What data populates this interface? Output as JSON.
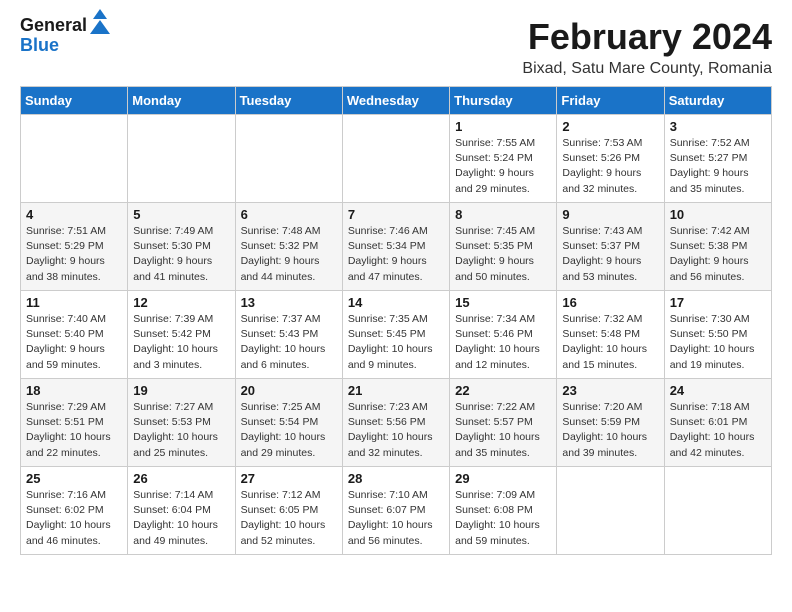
{
  "header": {
    "logo_line1": "General",
    "logo_line2": "Blue",
    "title": "February 2024",
    "subtitle": "Bixad, Satu Mare County, Romania"
  },
  "calendar": {
    "days_of_week": [
      "Sunday",
      "Monday",
      "Tuesday",
      "Wednesday",
      "Thursday",
      "Friday",
      "Saturday"
    ],
    "weeks": [
      [
        {
          "day": "",
          "info": ""
        },
        {
          "day": "",
          "info": ""
        },
        {
          "day": "",
          "info": ""
        },
        {
          "day": "",
          "info": ""
        },
        {
          "day": "1",
          "info": "Sunrise: 7:55 AM\nSunset: 5:24 PM\nDaylight: 9 hours\nand 29 minutes."
        },
        {
          "day": "2",
          "info": "Sunrise: 7:53 AM\nSunset: 5:26 PM\nDaylight: 9 hours\nand 32 minutes."
        },
        {
          "day": "3",
          "info": "Sunrise: 7:52 AM\nSunset: 5:27 PM\nDaylight: 9 hours\nand 35 minutes."
        }
      ],
      [
        {
          "day": "4",
          "info": "Sunrise: 7:51 AM\nSunset: 5:29 PM\nDaylight: 9 hours\nand 38 minutes."
        },
        {
          "day": "5",
          "info": "Sunrise: 7:49 AM\nSunset: 5:30 PM\nDaylight: 9 hours\nand 41 minutes."
        },
        {
          "day": "6",
          "info": "Sunrise: 7:48 AM\nSunset: 5:32 PM\nDaylight: 9 hours\nand 44 minutes."
        },
        {
          "day": "7",
          "info": "Sunrise: 7:46 AM\nSunset: 5:34 PM\nDaylight: 9 hours\nand 47 minutes."
        },
        {
          "day": "8",
          "info": "Sunrise: 7:45 AM\nSunset: 5:35 PM\nDaylight: 9 hours\nand 50 minutes."
        },
        {
          "day": "9",
          "info": "Sunrise: 7:43 AM\nSunset: 5:37 PM\nDaylight: 9 hours\nand 53 minutes."
        },
        {
          "day": "10",
          "info": "Sunrise: 7:42 AM\nSunset: 5:38 PM\nDaylight: 9 hours\nand 56 minutes."
        }
      ],
      [
        {
          "day": "11",
          "info": "Sunrise: 7:40 AM\nSunset: 5:40 PM\nDaylight: 9 hours\nand 59 minutes."
        },
        {
          "day": "12",
          "info": "Sunrise: 7:39 AM\nSunset: 5:42 PM\nDaylight: 10 hours\nand 3 minutes."
        },
        {
          "day": "13",
          "info": "Sunrise: 7:37 AM\nSunset: 5:43 PM\nDaylight: 10 hours\nand 6 minutes."
        },
        {
          "day": "14",
          "info": "Sunrise: 7:35 AM\nSunset: 5:45 PM\nDaylight: 10 hours\nand 9 minutes."
        },
        {
          "day": "15",
          "info": "Sunrise: 7:34 AM\nSunset: 5:46 PM\nDaylight: 10 hours\nand 12 minutes."
        },
        {
          "day": "16",
          "info": "Sunrise: 7:32 AM\nSunset: 5:48 PM\nDaylight: 10 hours\nand 15 minutes."
        },
        {
          "day": "17",
          "info": "Sunrise: 7:30 AM\nSunset: 5:50 PM\nDaylight: 10 hours\nand 19 minutes."
        }
      ],
      [
        {
          "day": "18",
          "info": "Sunrise: 7:29 AM\nSunset: 5:51 PM\nDaylight: 10 hours\nand 22 minutes."
        },
        {
          "day": "19",
          "info": "Sunrise: 7:27 AM\nSunset: 5:53 PM\nDaylight: 10 hours\nand 25 minutes."
        },
        {
          "day": "20",
          "info": "Sunrise: 7:25 AM\nSunset: 5:54 PM\nDaylight: 10 hours\nand 29 minutes."
        },
        {
          "day": "21",
          "info": "Sunrise: 7:23 AM\nSunset: 5:56 PM\nDaylight: 10 hours\nand 32 minutes."
        },
        {
          "day": "22",
          "info": "Sunrise: 7:22 AM\nSunset: 5:57 PM\nDaylight: 10 hours\nand 35 minutes."
        },
        {
          "day": "23",
          "info": "Sunrise: 7:20 AM\nSunset: 5:59 PM\nDaylight: 10 hours\nand 39 minutes."
        },
        {
          "day": "24",
          "info": "Sunrise: 7:18 AM\nSunset: 6:01 PM\nDaylight: 10 hours\nand 42 minutes."
        }
      ],
      [
        {
          "day": "25",
          "info": "Sunrise: 7:16 AM\nSunset: 6:02 PM\nDaylight: 10 hours\nand 46 minutes."
        },
        {
          "day": "26",
          "info": "Sunrise: 7:14 AM\nSunset: 6:04 PM\nDaylight: 10 hours\nand 49 minutes."
        },
        {
          "day": "27",
          "info": "Sunrise: 7:12 AM\nSunset: 6:05 PM\nDaylight: 10 hours\nand 52 minutes."
        },
        {
          "day": "28",
          "info": "Sunrise: 7:10 AM\nSunset: 6:07 PM\nDaylight: 10 hours\nand 56 minutes."
        },
        {
          "day": "29",
          "info": "Sunrise: 7:09 AM\nSunset: 6:08 PM\nDaylight: 10 hours\nand 59 minutes."
        },
        {
          "day": "",
          "info": ""
        },
        {
          "day": "",
          "info": ""
        }
      ]
    ]
  }
}
